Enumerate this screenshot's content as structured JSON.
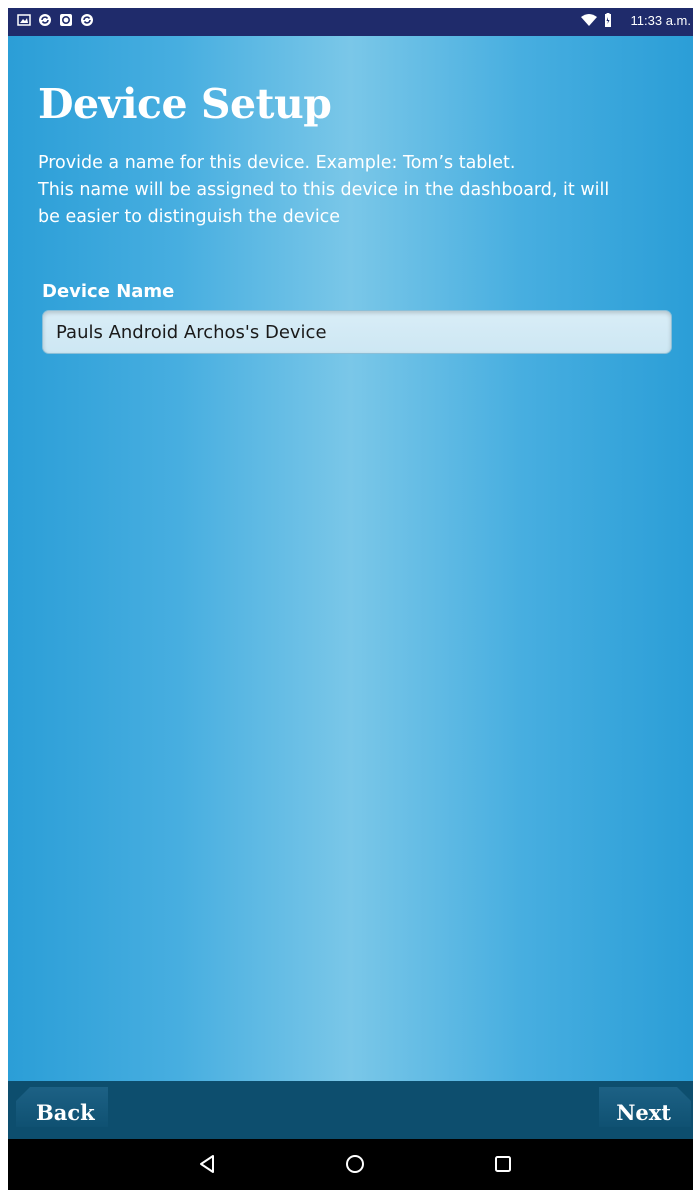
{
  "status_bar": {
    "left_icons": [
      "gallery-icon",
      "sync-icon",
      "app-icon",
      "sync-icon"
    ],
    "right_icons": [
      "wifi-icon",
      "battery-icon"
    ],
    "time": "11:33 a.m."
  },
  "header": {
    "title": "Device Setup"
  },
  "description": {
    "line1": "Provide a name for this device. Example: Tom’s tablet.",
    "line2": "This name will be assigned to this device in the dashboard, it will",
    "line3": "be easier to distinguish the device"
  },
  "form": {
    "device_name_label": "Device Name",
    "device_name_value": "Pauls Android Archos's Device"
  },
  "footer": {
    "back_label": "Back",
    "next_label": "Next"
  },
  "system_nav": {
    "icons": [
      "back-triangle-icon",
      "home-circle-icon",
      "recents-square-icon"
    ]
  },
  "colors": {
    "status_bar": "#1f2b6b",
    "background_edge": "#2b9ed7",
    "background_center": "#7ac7e8",
    "action_bar": "#0d4e6e",
    "text": "#ffffff"
  }
}
